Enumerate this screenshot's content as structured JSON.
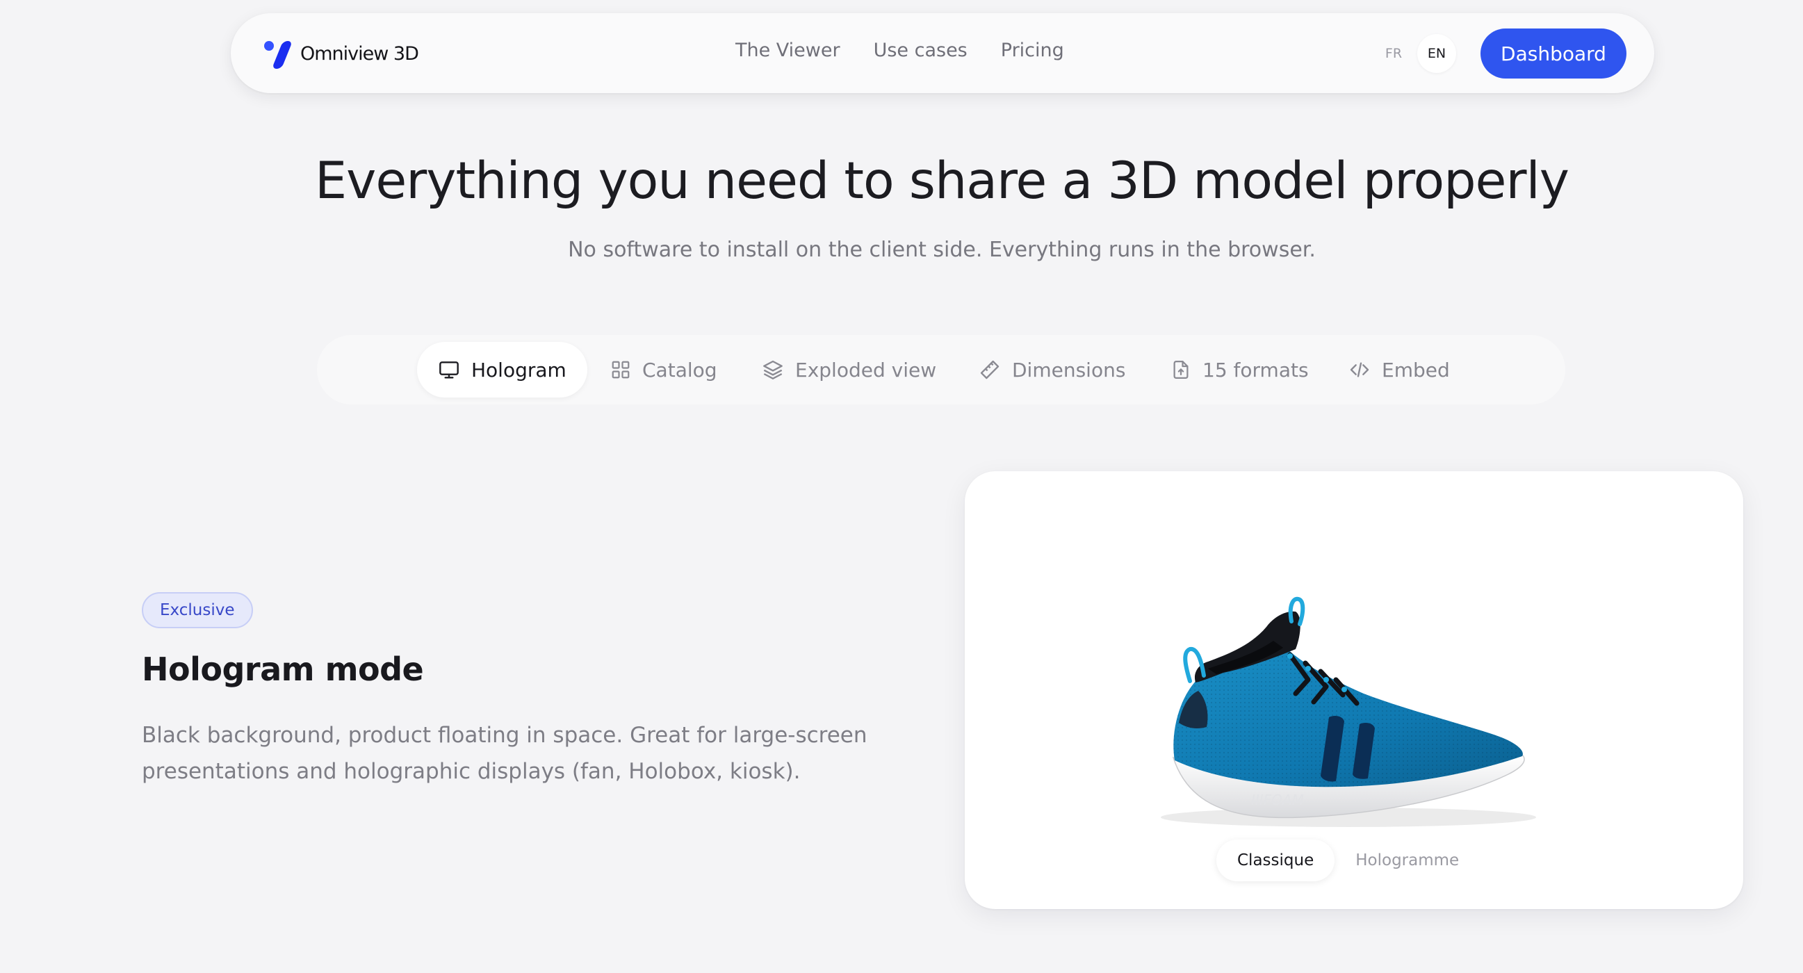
{
  "brand": {
    "name": "Omniview 3D",
    "accent": "#2f55ef"
  },
  "nav": {
    "links": [
      "The Viewer",
      "Use cases",
      "Pricing"
    ],
    "languages": [
      "FR",
      "EN"
    ],
    "active_language": "EN",
    "cta": "Dashboard"
  },
  "hero": {
    "title": "Everything you need to share a 3D model properly",
    "subtitle": "No software to install on the client side. Everything runs in the browser."
  },
  "tabs": [
    {
      "label": "Hologram",
      "icon": "monitor-icon",
      "active": true
    },
    {
      "label": "Catalog",
      "icon": "grid-icon",
      "active": false
    },
    {
      "label": "Exploded view",
      "icon": "layers-icon",
      "active": false
    },
    {
      "label": "Dimensions",
      "icon": "ruler-icon",
      "active": false
    },
    {
      "label": "15 formats",
      "icon": "file-upload-icon",
      "active": false
    },
    {
      "label": "Embed",
      "icon": "code-icon",
      "active": false
    }
  ],
  "feature": {
    "badge": "Exclusive",
    "title": "Hologram mode",
    "description": "Black background, product floating in space. Great for large-screen presentations and holographic displays (fan, Holobox, kiosk)."
  },
  "preview": {
    "model": "sneaker-3d-model",
    "modes": [
      "Classique",
      "Hologramme"
    ],
    "active_mode": "Classique"
  }
}
